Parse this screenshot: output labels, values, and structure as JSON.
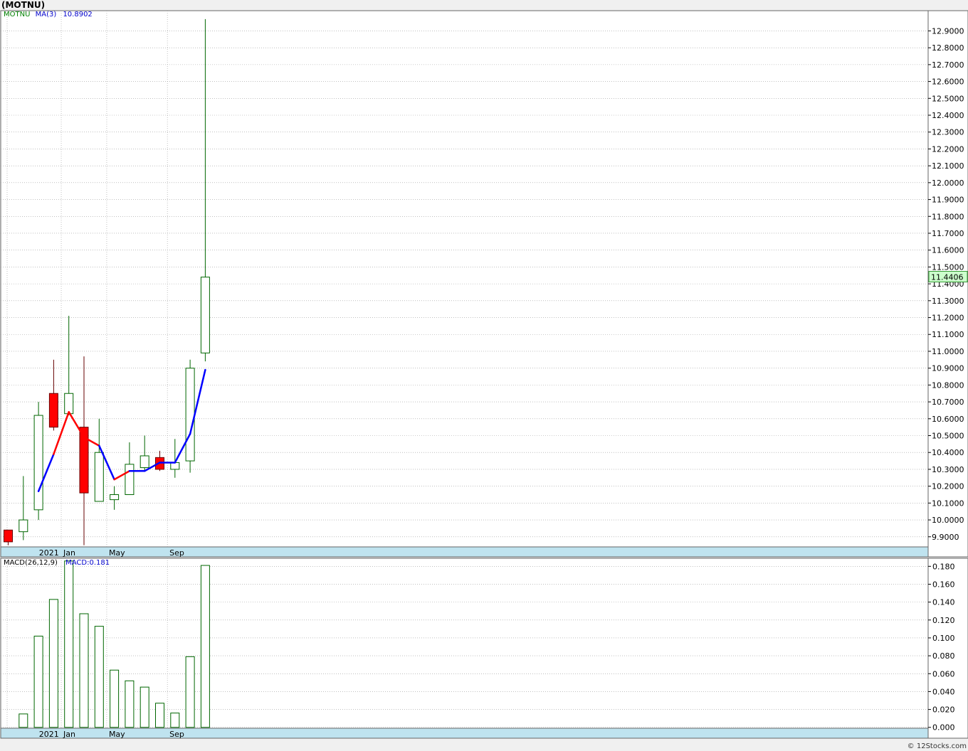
{
  "chart_data": [
    {
      "type": "candlestick",
      "title": "(MOTNU)",
      "symbol_label": "MOTNU",
      "ma_label": "MA(3)",
      "ma_value": "10.8902",
      "last_price": "11.4406",
      "y_ticks": [
        "9.9000",
        "10.0000",
        "10.1000",
        "10.2000",
        "10.3000",
        "10.4000",
        "10.5000",
        "10.6000",
        "10.7000",
        "10.8000",
        "10.9000",
        "11.0000",
        "11.1000",
        "11.2000",
        "11.3000",
        "11.4000",
        "11.5000",
        "11.6000",
        "11.7000",
        "11.8000",
        "11.9000",
        "12.0000",
        "12.1000",
        "12.2000",
        "12.3000",
        "12.4000",
        "12.5000",
        "12.6000",
        "12.7000",
        "12.8000",
        "12.9000"
      ],
      "ylim": [
        9.84,
        13.02
      ],
      "x_labels": [
        {
          "text": "2021",
          "index": 3
        },
        {
          "text": "Jan",
          "index": 4
        },
        {
          "text": "May",
          "index": 7
        },
        {
          "text": "Sep",
          "index": 11
        }
      ],
      "candles": [
        {
          "open": 9.94,
          "high": 9.94,
          "low": 9.85,
          "close": 9.87
        },
        {
          "open": 9.93,
          "high": 10.26,
          "low": 9.88,
          "close": 10.0
        },
        {
          "open": 10.06,
          "high": 10.7,
          "low": 10.0,
          "close": 10.62
        },
        {
          "open": 10.75,
          "high": 10.95,
          "low": 10.53,
          "close": 10.55
        },
        {
          "open": 10.63,
          "high": 11.21,
          "low": 10.62,
          "close": 10.75
        },
        {
          "open": 10.55,
          "high": 10.97,
          "low": 9.85,
          "close": 10.16
        },
        {
          "open": 10.11,
          "high": 10.6,
          "low": 10.11,
          "close": 10.4
        },
        {
          "open": 10.12,
          "high": 10.2,
          "low": 10.06,
          "close": 10.15
        },
        {
          "open": 10.15,
          "high": 10.46,
          "low": 10.15,
          "close": 10.33
        },
        {
          "open": 10.31,
          "high": 10.5,
          "low": 10.29,
          "close": 10.38
        },
        {
          "open": 10.37,
          "high": 10.41,
          "low": 10.29,
          "close": 10.3
        },
        {
          "open": 10.3,
          "high": 10.48,
          "low": 10.25,
          "close": 10.34
        },
        {
          "open": 10.35,
          "high": 10.95,
          "low": 10.28,
          "close": 10.9
        },
        {
          "open": 10.99,
          "high": 12.97,
          "low": 10.94,
          "close": 11.44
        }
      ],
      "ma_points": [
        {
          "index": 2,
          "value": 10.17,
          "color": "#0000ff"
        },
        {
          "index": 3,
          "value": 10.39,
          "color": "#0000ff"
        },
        {
          "index": 4,
          "value": 10.64,
          "color": "#ff0000"
        },
        {
          "index": 5,
          "value": 10.49,
          "color": "#ff0000"
        },
        {
          "index": 6,
          "value": 10.44,
          "color": "#ff0000"
        },
        {
          "index": 7,
          "value": 10.24,
          "color": "#0000ff"
        },
        {
          "index": 8,
          "value": 10.29,
          "color": "#ff0000"
        },
        {
          "index": 9,
          "value": 10.29,
          "color": "#0000ff"
        },
        {
          "index": 10,
          "value": 10.34,
          "color": "#0000ff"
        },
        {
          "index": 11,
          "value": 10.34,
          "color": "#0000ff"
        },
        {
          "index": 12,
          "value": 10.51,
          "color": "#0000ff"
        },
        {
          "index": 13,
          "value": 10.89,
          "color": "#0000ff"
        }
      ]
    },
    {
      "type": "bar",
      "title": "",
      "indicator_label": "MACD(26,12,9)",
      "macd_label": "MACD:0.181",
      "y_ticks": [
        "0.000",
        "0.020",
        "0.040",
        "0.060",
        "0.080",
        "0.100",
        "0.120",
        "0.140",
        "0.160",
        "0.180"
      ],
      "ylim": [
        -0.001,
        0.189
      ],
      "categories": [
        1,
        2,
        3,
        4,
        5,
        6,
        7,
        8,
        9,
        10,
        11,
        12,
        13
      ],
      "values": [
        0.015,
        0.102,
        0.143,
        0.186,
        0.127,
        0.113,
        0.064,
        0.052,
        0.045,
        0.027,
        0.016,
        0.079,
        0.181
      ],
      "x_labels": [
        {
          "text": "2021",
          "index": 3
        },
        {
          "text": "Jan",
          "index": 4
        },
        {
          "text": "May",
          "index": 7
        },
        {
          "text": "Sep",
          "index": 11
        }
      ]
    }
  ],
  "footer": {
    "credit": "© 12Stocks.com"
  },
  "colors": {
    "up_body": "#ffffff",
    "down_body": "#ff0000",
    "wick_up": "#006600",
    "wick_down": "#660000",
    "axis_band": "#bfe3ef",
    "grid": "#9a9a9a",
    "last_price_bg": "#ccffcc",
    "bar_stroke": "#006600",
    "symbol_color": "#008000",
    "ma_color": "#0000cc"
  }
}
